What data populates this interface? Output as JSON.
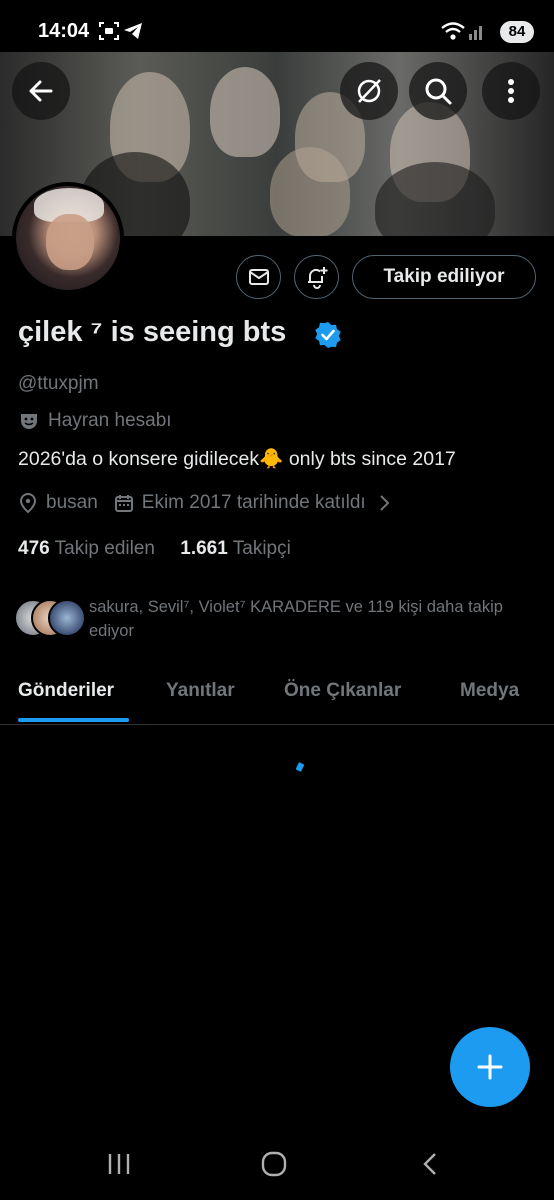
{
  "status_bar": {
    "time": "14:04",
    "battery": "84"
  },
  "header": {
    "back_icon": "arrow-left-icon",
    "grok_icon": "grok-icon",
    "search_icon": "search-icon",
    "more_icon": "more-vertical-icon"
  },
  "profile": {
    "name": "çilek ⁷ is seeing bts",
    "handle": "@ttuxpjm",
    "category": "Hayran hesabı",
    "bio": "2026'da o konsere gidilecek🐥 only bts since 2017",
    "location": "busan",
    "joined": "Ekim 2017 tarihinde katıldı",
    "following_count": "476",
    "following_label": "Takip edilen",
    "followers_count": "1.661",
    "followers_label": "Takipçi",
    "followed_by": "sakura, Sevil⁷, Violet⁷ KARADERE ve 119 kişi daha takip ediyor"
  },
  "actions": {
    "follow_state": "Takip ediliyor"
  },
  "tabs": [
    {
      "label": "Gönderiler",
      "active": true
    },
    {
      "label": "Yanıtlar"
    },
    {
      "label": "Öne Çıkanlar"
    },
    {
      "label": "Medya"
    }
  ],
  "colors": {
    "accent": "#1d9bf0",
    "background": "#000000",
    "muted": "#71767b"
  }
}
